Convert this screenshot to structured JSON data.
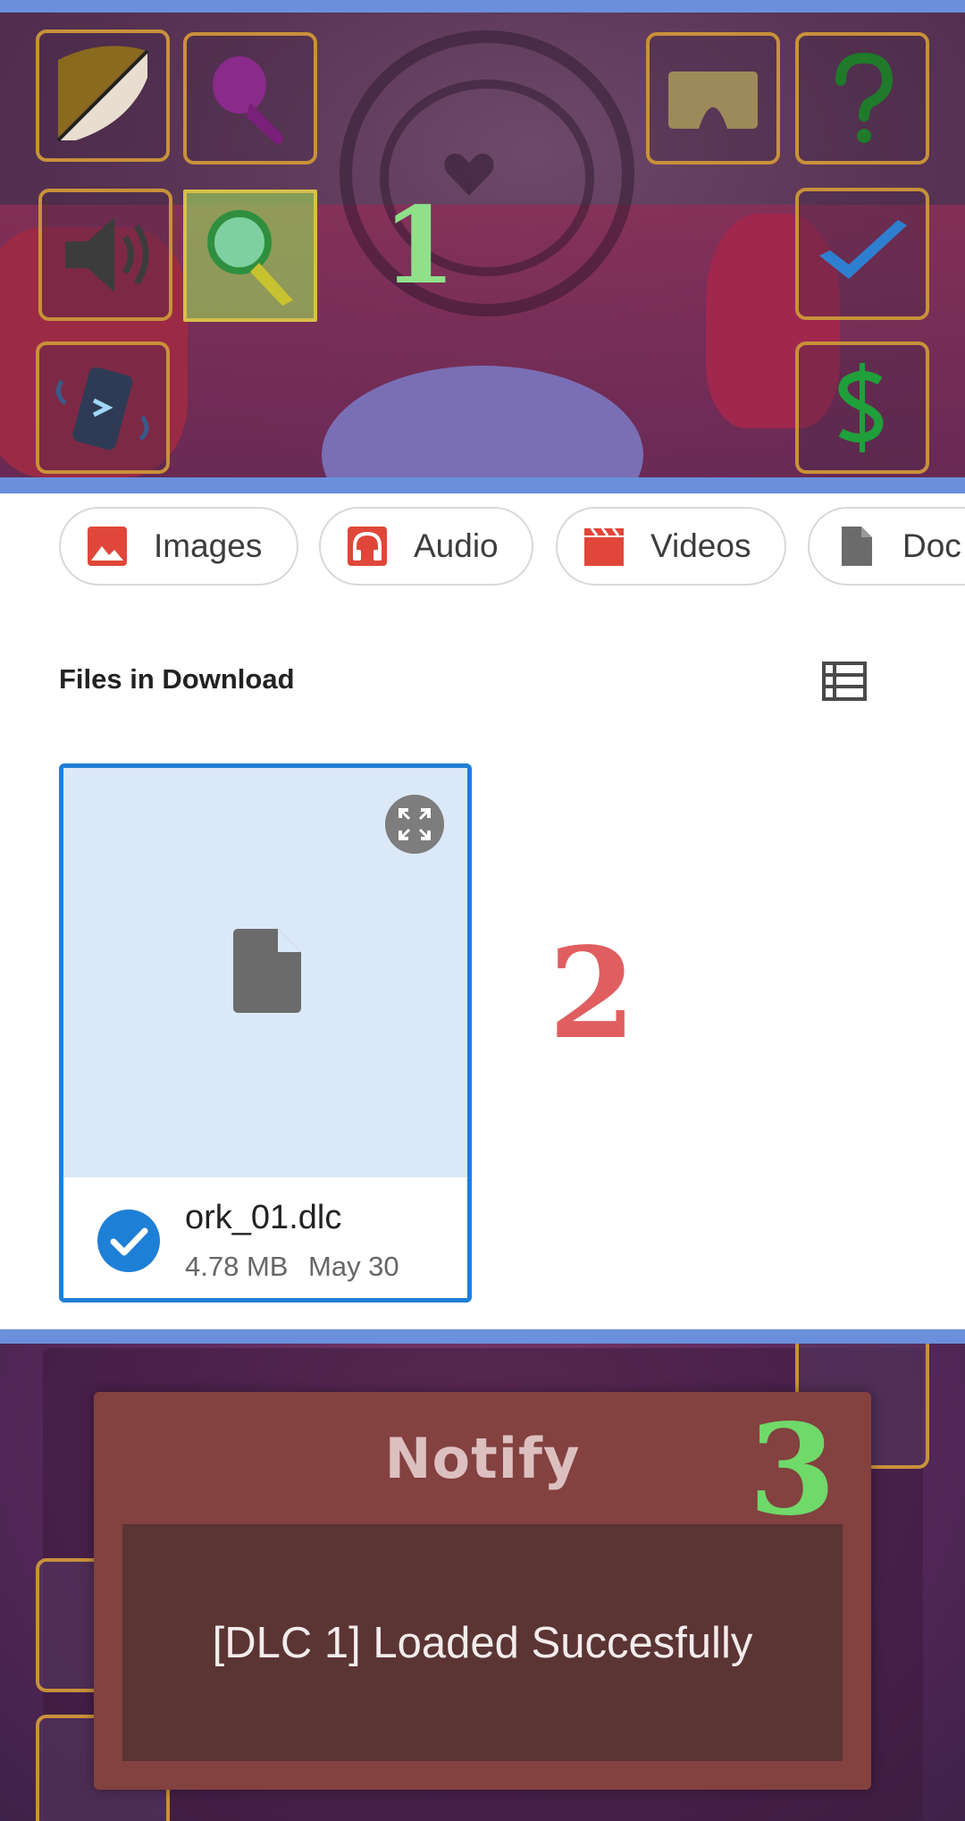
{
  "panel1": {
    "label": "1",
    "label_color": "#8fe08a",
    "buttons_left": [
      {
        "icon": "color-palette-icon",
        "active": false
      },
      {
        "icon": "paint-brush-icon",
        "active": false
      },
      {
        "icon": "speaker-icon",
        "active": false
      },
      {
        "icon": "magnifier-icon",
        "active": true
      },
      {
        "icon": "phone-shake-icon",
        "active": false
      }
    ],
    "buttons_right": [
      {
        "icon": "vr-headset-icon"
      },
      {
        "icon": "help-question-icon"
      },
      {
        "icon": "checkmark-icon"
      },
      {
        "icon": "dollar-icon"
      }
    ]
  },
  "panel2": {
    "label": "2",
    "label_color": "#e05e60",
    "chips": [
      {
        "label": "Images",
        "icon": "image-icon"
      },
      {
        "label": "Audio",
        "icon": "headphones-icon"
      },
      {
        "label": "Videos",
        "icon": "video-clapper-icon"
      },
      {
        "label": "Doc",
        "icon": "document-icon"
      }
    ],
    "section_title": "Files in Download",
    "file": {
      "name": "ork_01.dlc",
      "size": "4.78 MB",
      "date": "May 30",
      "selected": true
    },
    "accent": "#1e7fd6"
  },
  "panel3": {
    "label": "3",
    "label_color": "#6fd96a",
    "dialog_title": "Notify",
    "message": "[DLC 1] Loaded Succesfully"
  }
}
